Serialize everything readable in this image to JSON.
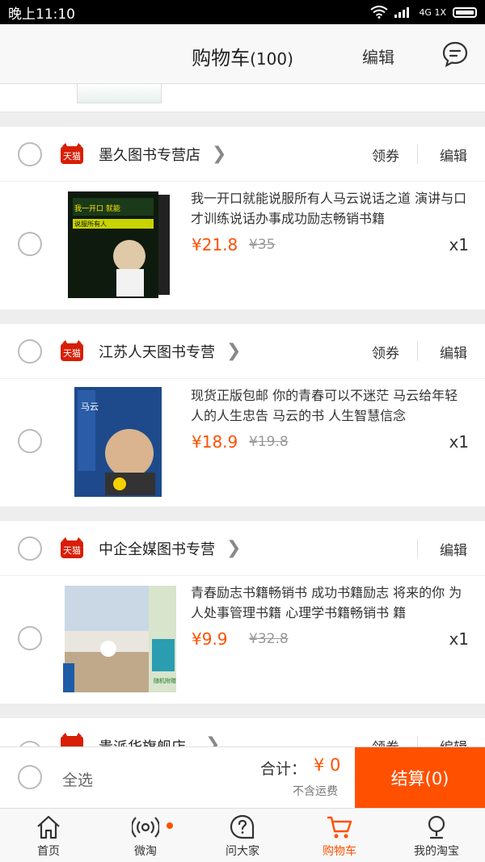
{
  "status_bar": {
    "time": "晚上11:10",
    "network": "4G 1X"
  },
  "nav": {
    "title": "购物车",
    "count": "(100)",
    "edit_label": "编辑"
  },
  "stores": [
    {
      "name": "墨久图书专营店",
      "coupon_label": "领券",
      "edit_label": "编辑",
      "badge_text": "天猫",
      "item": {
        "title": "我一开口就能说服所有人马云说话之道 演讲与口才训练说话办事成功励志畅销书籍",
        "price": "¥21.8",
        "original_price": "¥35",
        "qty": "x1",
        "cover_text": "我一开口 就能说服所有人 马云说话之道"
      }
    },
    {
      "name": "江苏人天图书专营",
      "coupon_label": "领券",
      "edit_label": "编辑",
      "badge_text": "天猫",
      "item": {
        "title": "现货正版包邮 你的青春可以不迷茫 马云给年轻人的人生忠告 马云的书 人生智慧信念",
        "price": "¥18.9",
        "original_price": "¥19.8",
        "qty": "x1",
        "cover_text": "马云 你的青春可以不迷茫"
      }
    },
    {
      "name": "中企全媒图书专营",
      "coupon_label": "",
      "edit_label": "编辑",
      "badge_text": "天猫",
      "item": {
        "title": "青春励志书籍畅销书 成功书籍励志 将来的你 为人处事管理书籍 心理学书籍畅销书 籍",
        "price": "¥9.9",
        "original_price": "¥32.8",
        "qty": "x1",
        "cover_text": "将来的你，一定会感谢现在拼命的自己 随机附赠精美书签"
      }
    }
  ],
  "partial_store": {
    "name": "贵派华旗舰店",
    "coupon_label": "领券",
    "edit_label": "编辑"
  },
  "checkout": {
    "select_all_label": "全选",
    "total_label": "合计：",
    "total_value": "¥ 0",
    "shipping_note": "不含运费",
    "checkout_label": "结算(0)"
  },
  "tabs": [
    {
      "label": "首页",
      "icon": "home-icon",
      "active": false
    },
    {
      "label": "微淘",
      "icon": "broadcast-icon",
      "active": false
    },
    {
      "label": "问大家",
      "icon": "question-icon",
      "active": false
    },
    {
      "label": "购物车",
      "icon": "cart-icon",
      "active": true
    },
    {
      "label": "我的淘宝",
      "icon": "user-icon",
      "active": false
    }
  ],
  "colors": {
    "accent": "#ff5000",
    "tmall_red": "#d81e06"
  }
}
